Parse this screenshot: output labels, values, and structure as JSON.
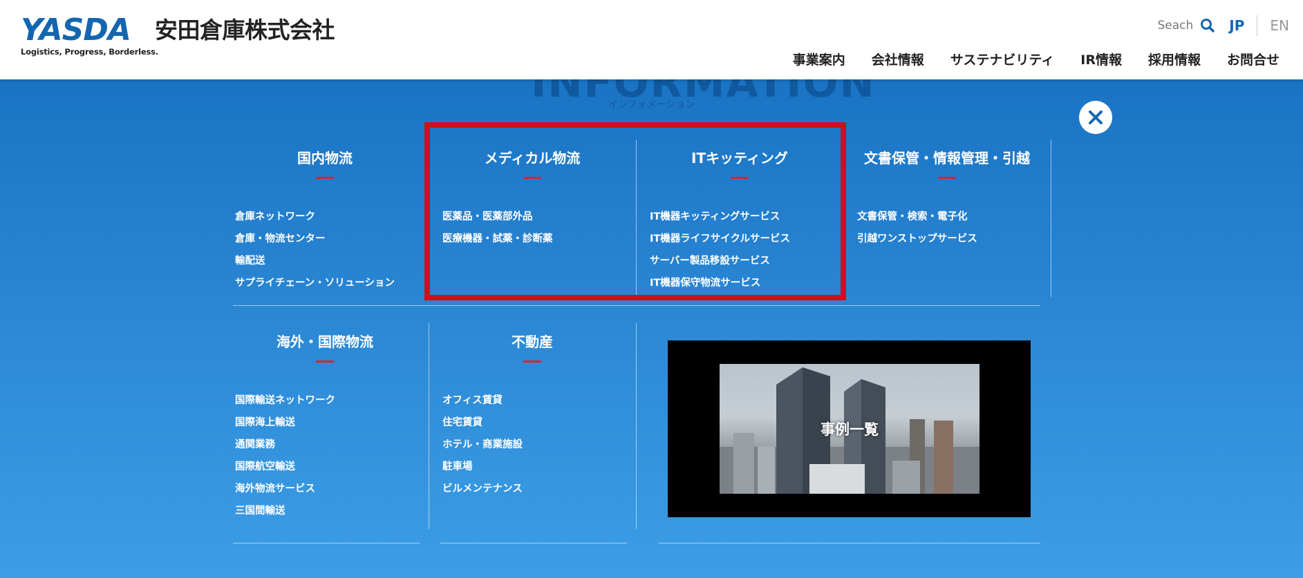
{
  "header": {
    "logo_mark": "YASDA",
    "logo_tagline": "Logistics, Progress, Borderless.",
    "company_name": "安田倉庫株式会社",
    "search_label": "Seach",
    "lang_jp": "JP",
    "lang_en": "EN",
    "nav": [
      "事業案内",
      "会社情報",
      "サステナビリティ",
      "IR情報",
      "採用情報",
      "お問合せ"
    ]
  },
  "background": {
    "heading": "INFORMATION",
    "subheading": "インフォメーション"
  },
  "menu": {
    "domestic": {
      "title": "国内物流",
      "items": [
        "倉庫ネットワーク",
        "倉庫・物流センター",
        "輸配送",
        "サプライチェーン・ソリューション"
      ]
    },
    "medical": {
      "title": "メディカル物流",
      "items": [
        "医薬品・医薬部外品",
        "医療機器・試薬・診断薬"
      ]
    },
    "it": {
      "title": "ITキッティング",
      "items": [
        "IT機器キッティングサービス",
        "IT機器ライフサイクルサービス",
        "サーバー製品移設サービス",
        "IT機器保守物流サービス"
      ]
    },
    "documents": {
      "title": "文書保管・情報管理・引越",
      "items": [
        "文書保管・検索・電子化",
        "引越ワンストップサービス"
      ]
    },
    "international": {
      "title": "海外・国際物流",
      "items": [
        "国際輸送ネットワーク",
        "国際海上輸送",
        "通関業務",
        "国際航空輸送",
        "海外物流サービス",
        "三国間輸送"
      ]
    },
    "real_estate": {
      "title": "不動産",
      "items": [
        "オフィス賃貸",
        "住宅賃貸",
        "ホテル・商業施設",
        "駐車場",
        "ビルメンテナンス"
      ]
    },
    "case_study_label": "事例一覧"
  },
  "colors": {
    "brand": "#1466b0",
    "accent_red": "#e0202c",
    "highlight": "#d01019"
  }
}
